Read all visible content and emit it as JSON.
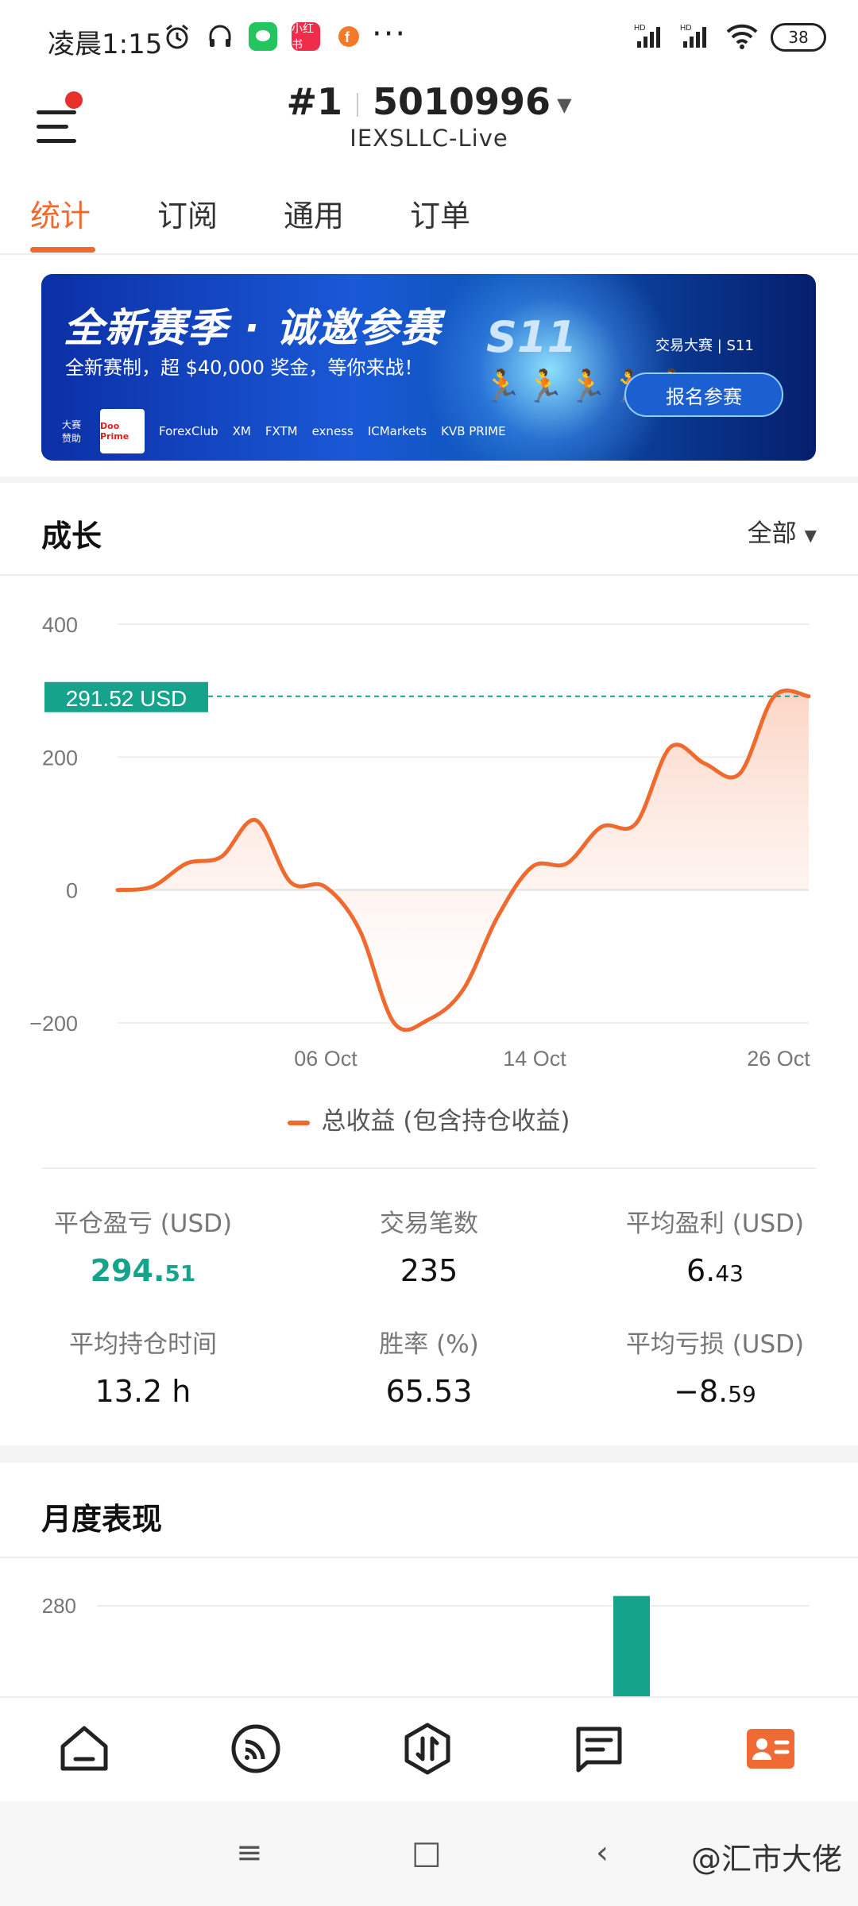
{
  "status_bar": {
    "time": "凌晨1:15",
    "app_icon_label": "小红书",
    "more": "···",
    "battery": "38",
    "signal_label": "HD"
  },
  "header": {
    "rank": "#1",
    "account_id": "5010996",
    "server": "IEXSLLC-Live"
  },
  "tabs": [
    {
      "label": "统计",
      "active": true
    },
    {
      "label": "订阅",
      "active": false
    },
    {
      "label": "通用",
      "active": false
    },
    {
      "label": "订单",
      "active": false
    }
  ],
  "banner": {
    "title": "全新赛季 · 诚邀参赛",
    "subtitle": "全新赛制，超 $40,000 奖金，等你来战！",
    "season": "S11",
    "brand": "交易大赛 | S11",
    "button": "报名参赛",
    "sponsor_label": "大赛赞助",
    "sponsors": [
      "Doo Prime",
      "ForexClub",
      "XM",
      "FXTM",
      "exness",
      "ICMarkets",
      "KVB PRIME"
    ]
  },
  "growth": {
    "title": "成长",
    "filter": "全部",
    "legend": "总收益 (包含持仓收益)"
  },
  "chart_data": {
    "type": "area",
    "x": [
      "09-28",
      "09-30",
      "10-01",
      "10-02",
      "10-03",
      "10-04",
      "10-05",
      "10-06",
      "10-07",
      "10-08",
      "10-09",
      "10-10",
      "10-11",
      "10-12",
      "10-13",
      "10-14",
      "10-15",
      "10-16",
      "10-17",
      "10-18",
      "10-19",
      "10-20",
      "10-21",
      "10-22",
      "10-23",
      "10-24",
      "10-25",
      "10-26"
    ],
    "x_ticks": [
      "06 Oct",
      "14 Oct",
      "26 Oct"
    ],
    "series": [
      {
        "name": "总收益 (包含持仓收益)",
        "values": [
          0,
          5,
          40,
          50,
          105,
          12,
          5,
          -60,
          -200,
          -195,
          -150,
          -40,
          35,
          40,
          95,
          100,
          215,
          190,
          175,
          291.52,
          291.52
        ],
        "color": "#ef6a2e"
      }
    ],
    "yticks": [
      400,
      200,
      0,
      -200
    ],
    "ylim": [
      -200,
      400
    ],
    "current_label": "291.52 USD",
    "current_value": 291.52,
    "current_color": "#15a38b",
    "fill_color": "#fbd3c2"
  },
  "stats": [
    {
      "label": "平仓盈亏 (USD)",
      "value_main": "294.",
      "value_small": "51",
      "accent": "green"
    },
    {
      "label": "交易笔数",
      "value_main": "235",
      "value_small": ""
    },
    {
      "label": "平均盈利 (USD)",
      "value_main": "6.",
      "value_small": "43"
    },
    {
      "label": "平均持仓时间",
      "value_main": "13.2 h",
      "value_small": ""
    },
    {
      "label": "胜率 (%)",
      "value_main": "65.53",
      "value_small": ""
    },
    {
      "label": "平均亏损 (USD)",
      "value_main": "−8.",
      "value_small": "59"
    }
  ],
  "monthly": {
    "title": "月度表现",
    "ytick": "280",
    "bar_color": "#15a38b",
    "bar_value": 291.52
  },
  "bottom_nav": [
    {
      "icon": "home-icon"
    },
    {
      "icon": "signal-icon"
    },
    {
      "icon": "trade-icon"
    },
    {
      "icon": "message-icon"
    },
    {
      "icon": "profile-card-icon",
      "active": true,
      "color": "#f06a35"
    }
  ],
  "system_nav": {
    "menu": "≡",
    "home": "□",
    "back": "‹",
    "watermark": "@汇市大佬"
  }
}
